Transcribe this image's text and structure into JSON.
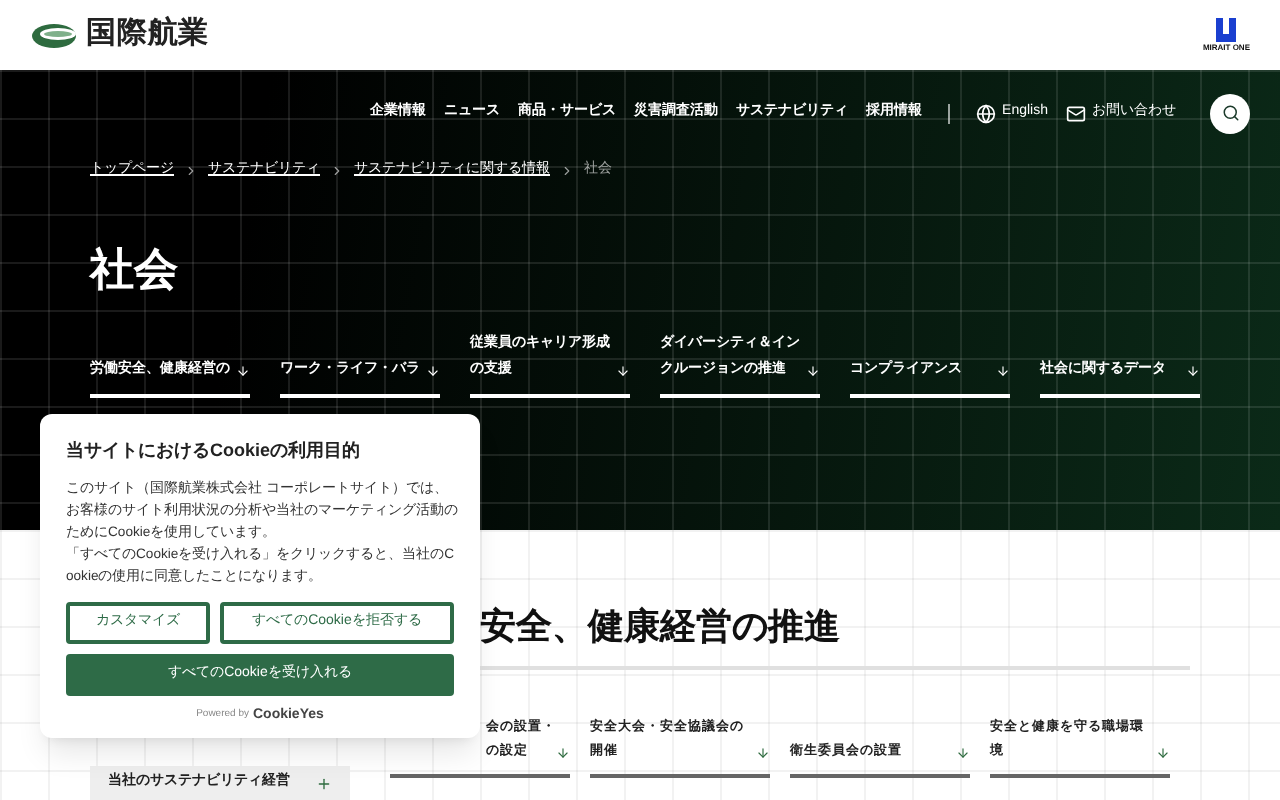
{
  "header": {
    "logo_text": "国際航業",
    "group_logo_text": "MIRAIT ONE"
  },
  "nav": {
    "items": [
      "企業情報",
      "ニュース",
      "商品・サービス",
      "災害調査活動",
      "サステナビリティ",
      "採用情報"
    ],
    "language": "English",
    "contact": "お問い合わせ"
  },
  "breadcrumbs": [
    {
      "label": "トップページ",
      "link": true
    },
    {
      "label": "サステナビリティ",
      "link": true
    },
    {
      "label": "サステナビリティに関する情報",
      "link": true
    },
    {
      "label": "社会",
      "link": false
    }
  ],
  "page_title": "社会",
  "anchor_links": [
    {
      "lines": [
        "労働安全、健康経営の"
      ]
    },
    {
      "lines": [
        "ワーク・ライフ・バラ"
      ]
    },
    {
      "lines": [
        "従業員のキャリア形成",
        "の支援"
      ]
    },
    {
      "lines": [
        "ダイバーシティ＆イン",
        "クルージョンの推進"
      ]
    },
    {
      "lines": [
        "コンプライアンス"
      ]
    },
    {
      "lines": [
        "社会に関するデータ"
      ]
    }
  ],
  "section": {
    "heading": "安全、健康経営の推進",
    "links": [
      {
        "lines": [
          "会の設置・",
          "の設定"
        ]
      },
      {
        "lines": [
          "安全大会・安全協議会の",
          "開催"
        ]
      },
      {
        "lines": [
          "衛生委員会の設置"
        ]
      },
      {
        "lines": [
          "安全と健康を守る職場環",
          "境"
        ]
      }
    ]
  },
  "sidebar": {
    "items": [
      {
        "label": "当社のサステナビリティ経営",
        "expanded": false
      }
    ]
  },
  "cookie_dialog": {
    "title": "当サイトにおけるCookieの利用目的",
    "body": [
      "このサイト（国際航業株式会社 コーポレートサイト）では、お客様のサイト利用状況の分析や当社のマーケティング活動のためにCookieを使用しています。",
      "「すべてのCookieを受け入れる」をクリックすると、当社のCookieの使用に同意したことになります。"
    ],
    "buttons": [
      {
        "label": "カスタマイズ",
        "kind": "outline"
      },
      {
        "label": "すべてのCookieを拒否する",
        "kind": "outline"
      },
      {
        "label": "すべてのCookieを受け入れる",
        "kind": "primary"
      }
    ],
    "powered_by": "Powered by",
    "brand": "CookieYes"
  }
}
